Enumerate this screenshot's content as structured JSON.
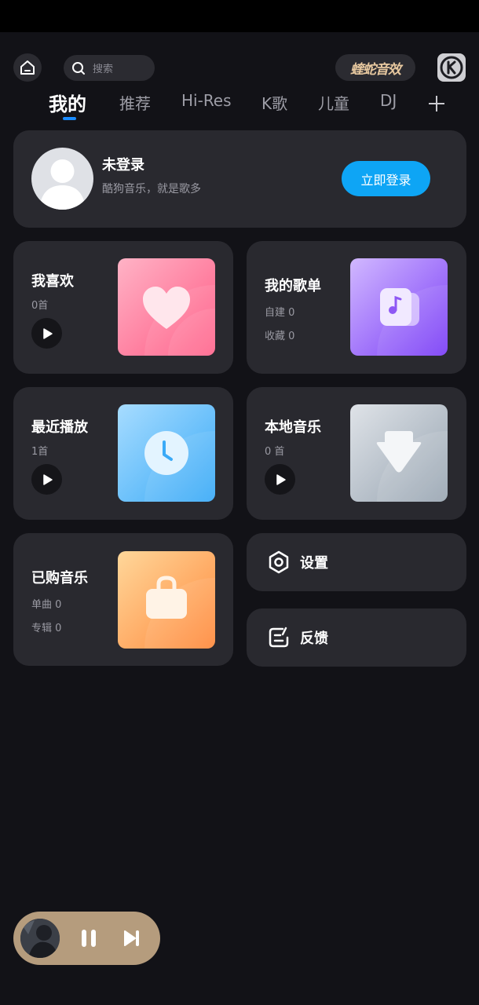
{
  "header": {
    "search_placeholder": "搜索",
    "effect_label": "蝰蛇音效"
  },
  "tabs": [
    {
      "label": "我的",
      "active": true
    },
    {
      "label": "推荐"
    },
    {
      "label": "Hi-Res"
    },
    {
      "label": "K歌"
    },
    {
      "label": "儿童"
    },
    {
      "label": "DJ"
    }
  ],
  "login": {
    "title": "未登录",
    "subtitle": "酷狗音乐，就是歌多",
    "button": "立即登录"
  },
  "tiles": {
    "favorites": {
      "title": "我喜欢",
      "count": "0首"
    },
    "playlists": {
      "title": "我的歌单",
      "created": "自建 0",
      "collected": "收藏 0"
    },
    "recent": {
      "title": "最近播放",
      "count": "1首"
    },
    "local": {
      "title": "本地音乐",
      "count": "0 首"
    },
    "purchased": {
      "title": "已购音乐",
      "singles": "单曲 0",
      "albums": "专辑 0"
    },
    "settings": {
      "label": "设置"
    },
    "feedback": {
      "label": "反馈"
    }
  },
  "mini_player": {
    "playing": true
  },
  "colors": {
    "background": "#121217",
    "card": "#29292f",
    "accent_blue": "#0ea5f5",
    "tab_indicator": "#1a8cff",
    "effect_gold": "#e8c9a0",
    "player_bg": "#b59c7d"
  }
}
